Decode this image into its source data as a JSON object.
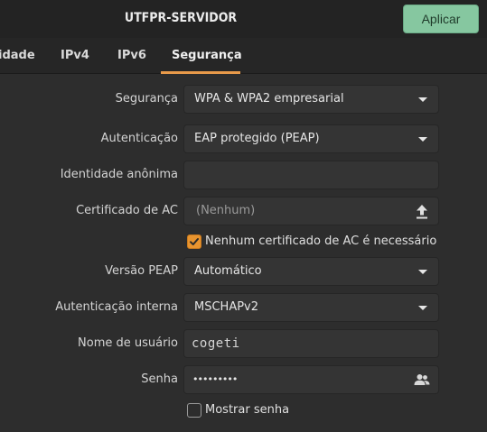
{
  "header": {
    "title": "UTFPR-SERVIDOR",
    "apply_label": "Aplicar"
  },
  "tabs": [
    {
      "label": "idade"
    },
    {
      "label": "IPv4"
    },
    {
      "label": "IPv6"
    },
    {
      "label": "Segurança",
      "active": true
    }
  ],
  "form": {
    "security": {
      "label": "Segurança",
      "value": "WPA & WPA2 empresarial"
    },
    "authentication": {
      "label": "Autenticação",
      "value": "EAP protegido (PEAP)"
    },
    "anonymous_identity": {
      "label": "Identidade anônima",
      "value": ""
    },
    "ca_certificate": {
      "label": "Certificado de AC",
      "value": "(Nenhum)"
    },
    "no_ca_required": {
      "label": "Nenhum certificado de AC é necessário",
      "checked": true
    },
    "peap_version": {
      "label": "Versão PEAP",
      "value": "Automático"
    },
    "inner_auth": {
      "label": "Autenticação interna",
      "value": "MSCHAPv2"
    },
    "username": {
      "label": "Nome de usuário",
      "value": "cogeti"
    },
    "password": {
      "label": "Senha",
      "value": "•••••••••"
    },
    "show_password": {
      "label": "Mostrar senha",
      "checked": false
    }
  },
  "colors": {
    "accent": "#e8942f",
    "apply_button": "#86c7a0"
  }
}
